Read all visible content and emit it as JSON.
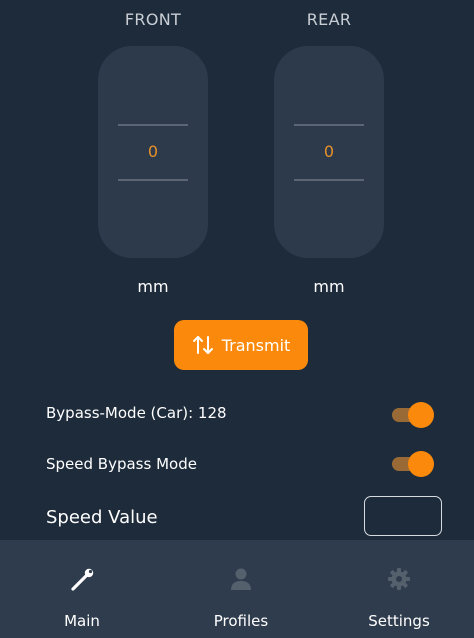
{
  "suspension": {
    "front": {
      "label": "FRONT",
      "value": "0",
      "unit": "mm"
    },
    "rear": {
      "label": "REAR",
      "value": "0",
      "unit": "mm"
    }
  },
  "transmit": {
    "label": "Transmit",
    "icon": "swap-vertical-icon"
  },
  "bypass_mode": {
    "label": "Bypass-Mode (Car): 128",
    "enabled": true
  },
  "speed_bypass_mode": {
    "label": "Speed Bypass Mode",
    "enabled": true
  },
  "speed_value": {
    "label": "Speed Value",
    "value": ""
  },
  "tabs": [
    {
      "label": "Main",
      "icon": "wrench-icon",
      "active": true
    },
    {
      "label": "Profiles",
      "icon": "person-icon",
      "active": false
    },
    {
      "label": "Settings",
      "icon": "gear-icon",
      "active": false
    }
  ],
  "colors": {
    "background": "#1d2b3b",
    "accent": "#fb8a0c",
    "value_text": "#e8912a",
    "tab_bar": "#2f3c4d"
  }
}
